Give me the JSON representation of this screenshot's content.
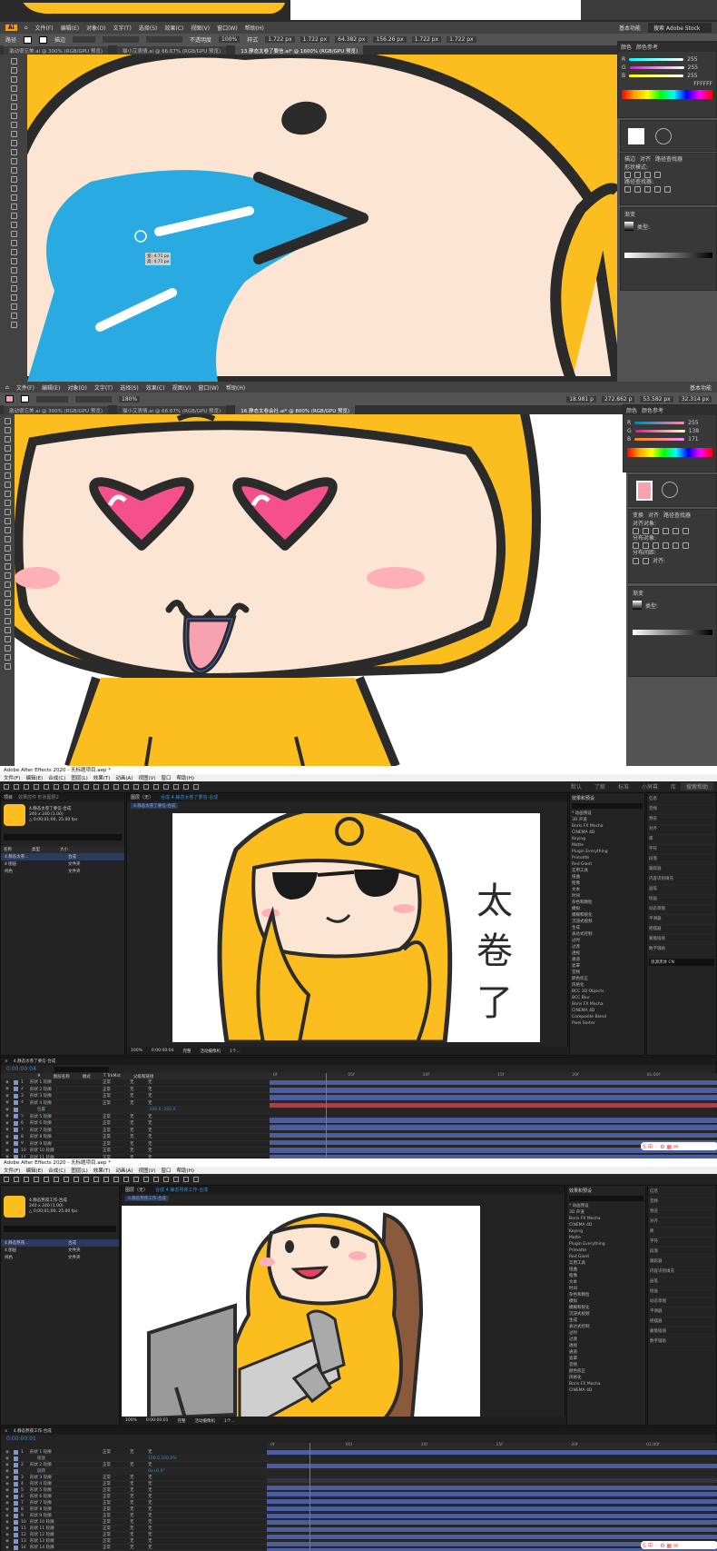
{
  "illustrator_top": {
    "menu": [
      "文件(F)",
      "编辑(E)",
      "对象(O)",
      "文字(T)",
      "选择(S)",
      "效果(C)",
      "视图(V)",
      "窗口(W)",
      "帮助(H)"
    ],
    "workspace": "基本功能",
    "search_placeholder": "搜索 Adobe Stock",
    "control": {
      "label": "路径",
      "stroke_label": "描边",
      "zoom": "100%",
      "opacity_label": "不透明度",
      "opacity": "100%",
      "style_label": "样式"
    },
    "coords": [
      "1.722 px",
      "1.722 px",
      "64.382 px",
      "156.26 px",
      "1.722 px",
      "1.722 px"
    ],
    "tabs": [
      "激动很忘美.ai @ 300% (RGB/GPU 预览)",
      "猫小艾表情.ai @ 66.67% (RGB/GPU 预览)",
      "13.静态太卷了要信.ai* @ 1600% (RGB/GPU 预览)"
    ],
    "tooltip": [
      "宽: 4.71 px",
      "高: 4.71 px"
    ],
    "color_panel": {
      "tabs": [
        "颜色",
        "颜色参考"
      ],
      "r": "255",
      "g": "255",
      "b": "255",
      "hex": "FFFFFF"
    },
    "transparency": [
      "描边",
      "对齐",
      "路径查找器",
      "形状模式:",
      "路径查找器:"
    ],
    "gradient_title": "渐变",
    "gradient_type_label": "类型:"
  },
  "illustrator_mid": {
    "menu": [
      "文件(F)",
      "编辑(E)",
      "对象(O)",
      "文字(T)",
      "选择(S)",
      "效果(C)",
      "视图(V)",
      "窗口(W)",
      "帮助(H)"
    ],
    "workspace": "基本功能",
    "coords": [
      "18.981 p",
      "272.862 p",
      "53.582 px",
      "32.314 px"
    ],
    "tabs": [
      "激动很忘美.ai @ 300% (RGB/GPU 预览)",
      "猫小艾表情.ai @ 66.67% (RGB/GPU 预览)",
      "16.静态太卷会社.ai* @ 800% (RGB/GPU 预览)"
    ],
    "color_panel": {
      "tabs": [
        "颜色",
        "颜色参考"
      ],
      "r": "255",
      "g": "138",
      "b": "171"
    },
    "panel_labels": [
      "变换",
      "对齐",
      "路径查找器",
      "对齐对象:",
      "分布对象:",
      "分布间距:",
      "对齐:"
    ],
    "gradient_title": "渐变",
    "gradient_type_label": "类型:",
    "gradient_angle": "180%"
  },
  "ae_top": {
    "title": "Adobe After Effects 2020 - 无标题项目.aep *",
    "menu": [
      "文件(F)",
      "编辑(E)",
      "合成(C)",
      "图层(L)",
      "效果(T)",
      "动画(A)",
      "视图(V)",
      "窗口",
      "帮助(H)"
    ],
    "workspace_tabs": [
      "默认",
      "了解",
      "标准",
      "小屏幕",
      "库"
    ],
    "search_placeholder": "搜索帮助",
    "project": {
      "tabs": [
        "项目",
        "效果控件 形状图层2"
      ],
      "comp_name": "4.静态太卷了要信-合成",
      "comp_info": "240 x 240 (1.00)",
      "duration": "△ 0;00;01;00, 25.00 fps",
      "cols": [
        "名称",
        "类型",
        "大小"
      ],
      "items": [
        {
          "name": "4.静态太卷...",
          "type": "合成"
        },
        {
          "name": "4 图层",
          "type": "文件夹"
        },
        {
          "name": "纯色",
          "type": "文件夹"
        }
      ]
    },
    "comp_tabs": [
      "图层（无）",
      "合成 4.静态太卷了要信-合成"
    ],
    "comp_breadcrumb": "4.静态太卷了要信-合成",
    "canvas_text": [
      "太",
      "卷",
      "了"
    ],
    "viewer_bar": [
      "100%",
      "0:00:00:04",
      "完整",
      "活动摄像机",
      "1个..."
    ],
    "effects_title": "效果和预设",
    "effects": [
      "* 动画预设",
      "3D 声道",
      "Boris FX Mocha",
      "CINEMA 4D",
      "Keying",
      "Matte",
      "Plugin Everything",
      "Primatte",
      "Red Giant",
      "实用工具",
      "扭曲",
      "抠像",
      "文本",
      "时间",
      "杂色和颗粒",
      "模拟",
      "模糊和锐化",
      "沉浸式视频",
      "生成",
      "表达式控制",
      "过时",
      "过渡",
      "透视",
      "通道",
      "遮罩",
      "音频",
      "颜色校正",
      "风格化",
      "BCC 3D Objects",
      "BCC Blur",
      "Boris FX Mocha",
      "CINEMA 4D",
      "Composite Blend",
      "Pixel Sorter"
    ],
    "right_panels": [
      "信息",
      "音频",
      "预览",
      "对齐",
      "库",
      "字符",
      "段落",
      "跟踪器",
      "内容识别填充",
      "画笔",
      "绘画",
      "动态草图",
      "平滑器",
      "摇摆器",
      "蒙版插值",
      "数字辅助"
    ],
    "char_font": "思源黑体 CN",
    "timeline": {
      "tab": "4.静态太卷了要信-合成",
      "time": "0:00:00:04",
      "cols": [
        "#",
        "图层名称",
        "模式",
        "T TrkMat",
        "父级和链接"
      ],
      "layers": [
        {
          "n": "1",
          "name": "形状 1 轮廓",
          "mode": "正常",
          "track": "无",
          "parent": "无"
        },
        {
          "n": "2",
          "name": "形状 2 轮廓",
          "mode": "正常",
          "track": "无",
          "parent": "无"
        },
        {
          "n": "3",
          "name": "形状 3 轮廓",
          "mode": "正常",
          "track": "无",
          "parent": "无"
        },
        {
          "n": "4",
          "name": "形状 4 轮廓",
          "mode": "正常",
          "track": "无",
          "parent": "无"
        },
        {
          "n": "",
          "name": "位置",
          "mode": "",
          "track": "",
          "parent": "-100.0,-100.0"
        },
        {
          "n": "5",
          "name": "形状 5 轮廓",
          "mode": "正常",
          "track": "无",
          "parent": "无"
        },
        {
          "n": "6",
          "name": "形状 6 轮廓",
          "mode": "正常",
          "track": "无",
          "parent": "无"
        },
        {
          "n": "7",
          "name": "形状 7 轮廓",
          "mode": "正常",
          "track": "无",
          "parent": "无"
        },
        {
          "n": "8",
          "name": "形状 8 轮廓",
          "mode": "正常",
          "track": "无",
          "parent": "无"
        },
        {
          "n": "9",
          "name": "形状 9 轮廓",
          "mode": "正常",
          "track": "无",
          "parent": "无"
        },
        {
          "n": "10",
          "name": "形状 10 轮廓",
          "mode": "正常",
          "track": "无",
          "parent": "无"
        },
        {
          "n": "11",
          "name": "形状 11 轮廓",
          "mode": "正常",
          "track": "无",
          "parent": "无"
        }
      ],
      "ruler": [
        "0f",
        "05f",
        "10f",
        "15f",
        "20f",
        "01:00f"
      ]
    }
  },
  "ae_bottom": {
    "title": "Adobe After Effects 2020 - 无标题项目.aep *",
    "menu": [
      "文件(F)",
      "编辑(E)",
      "合成(C)",
      "图层(L)",
      "效果(T)",
      "动画(A)",
      "视图(V)",
      "窗口",
      "帮助(H)"
    ],
    "project": {
      "comp_name": "4.静态熬夜工作-合成",
      "comp_info": "240 x 240 (1.00)",
      "duration": "△ 0;00;01;00, 25.00 fps",
      "items": [
        {
          "name": "4.静态熬夜...",
          "type": "合成"
        },
        {
          "name": "4 图层",
          "type": "文件夹"
        },
        {
          "name": "纯色",
          "type": "文件夹"
        }
      ]
    },
    "comp_tabs": [
      "图层（无）",
      "合成 4.静态熬夜工作-合成"
    ],
    "comp_breadcrumb": "4.静态熬夜工作-合成",
    "viewer_bar": [
      "100%",
      "0:00:00:01",
      "完整",
      "活动摄像机",
      "1个..."
    ],
    "effects_title": "效果和预设",
    "effects": [
      "* 动画预设",
      "3D 声道",
      "Boris FX Mocha",
      "CINEMA 4D",
      "Keying",
      "Matte",
      "Plugin Everything",
      "Primatte",
      "Red Giant",
      "实用工具",
      "扭曲",
      "抠像",
      "文本",
      "时间",
      "杂色和颗粒",
      "模拟",
      "模糊和锐化",
      "沉浸式视频",
      "生成",
      "表达式控制",
      "过时",
      "过渡",
      "透视",
      "通道",
      "遮罩",
      "音频",
      "颜色校正",
      "风格化",
      "Boris FX Mocha",
      "CINEMA 4D"
    ],
    "right_panels": [
      "信息",
      "音频",
      "预览",
      "对齐",
      "库",
      "字符",
      "段落",
      "跟踪器",
      "内容识别填充",
      "画笔",
      "绘画",
      "动态草图",
      "平滑器",
      "摇摆器",
      "蒙版插值",
      "数字辅助"
    ],
    "timeline": {
      "tab": "4.静态熬夜工作-合成",
      "time": "0:00:00:01",
      "layers": [
        {
          "n": "1",
          "name": "形状 1 轮廓",
          "mode": "正常",
          "track": "无",
          "parent": "无"
        },
        {
          "n": "",
          "name": "缩放",
          "mode": "",
          "track": "",
          "parent": "100.0,100.0%"
        },
        {
          "n": "2",
          "name": "形状 2 轮廓",
          "mode": "正常",
          "track": "无",
          "parent": "无"
        },
        {
          "n": "",
          "name": "旋转",
          "mode": "",
          "track": "",
          "parent": "0x+0.0°"
        },
        {
          "n": "3",
          "name": "形状 3 轮廓",
          "mode": "正常",
          "track": "无",
          "parent": "无"
        },
        {
          "n": "4",
          "name": "形状 4 轮廓",
          "mode": "正常",
          "track": "无",
          "parent": "无"
        },
        {
          "n": "5",
          "name": "形状 5 轮廓",
          "mode": "正常",
          "track": "无",
          "parent": "无"
        },
        {
          "n": "6",
          "name": "形状 6 轮廓",
          "mode": "正常",
          "track": "无",
          "parent": "无"
        },
        {
          "n": "7",
          "name": "形状 7 轮廓",
          "mode": "正常",
          "track": "无",
          "parent": "无"
        },
        {
          "n": "8",
          "name": "形状 8 轮廓",
          "mode": "正常",
          "track": "无",
          "parent": "无"
        },
        {
          "n": "9",
          "name": "形状 9 轮廓",
          "mode": "正常",
          "track": "无",
          "parent": "无"
        },
        {
          "n": "10",
          "name": "形状 10 轮廓",
          "mode": "正常",
          "track": "无",
          "parent": "无"
        },
        {
          "n": "11",
          "name": "形状 11 轮廓",
          "mode": "正常",
          "track": "无",
          "parent": "无"
        },
        {
          "n": "12",
          "name": "形状 12 轮廓",
          "mode": "正常",
          "track": "无",
          "parent": "无"
        },
        {
          "n": "13",
          "name": "形状 13 轮廓",
          "mode": "正常",
          "track": "无",
          "parent": "无"
        },
        {
          "n": "14",
          "name": "形状 14 轮廓",
          "mode": "正常",
          "track": "无",
          "parent": "无"
        }
      ],
      "ruler": [
        "0f",
        "05f",
        "10f",
        "15f",
        "20f",
        "01:00f"
      ]
    }
  },
  "colors": {
    "yellow": "#fcbd1e",
    "skin": "#fde5d3",
    "blue": "#29abe2",
    "pink": "#f5508b",
    "tongue": "#f7a1b1",
    "outline": "#2b2b2b",
    "ae_blue": "#4b5fa0",
    "ae_red": "#a4434a",
    "ae_accent": "#2d8ceb"
  }
}
